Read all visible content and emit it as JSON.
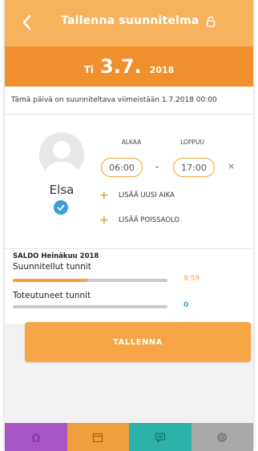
{
  "header": {
    "title": "Tallenna suunnitelma"
  },
  "date": {
    "day_of_week": "Ti",
    "day_month": "3.7.",
    "year": "2018"
  },
  "notice": "Tämä päivä on suunniteltava viimeistään 1.7.2018 00:00",
  "employee": {
    "name": "Elsa"
  },
  "shift": {
    "start_label": "ALKAA",
    "end_label": "LOPPUU",
    "start_time": "06:00",
    "end_time": "17:00",
    "separator": "-",
    "remove_symbol": "×"
  },
  "actions": {
    "add_time": "LISÄÄ UUSI AIKA",
    "add_absence": "LISÄÄ POISSAOLO",
    "plus_symbol": "+"
  },
  "saldo": {
    "title": "SALDO Heinäkuu 2018",
    "planned_label": "Suunnitellut tunnit",
    "planned_value": "9:59",
    "planned_progress": 0.48,
    "done_label": "Toteutuneet tunnit",
    "done_value": "0",
    "done_progress": 0
  },
  "save_button": "TALLENNA",
  "colors": {
    "header": "#f6b25c",
    "date_bar": "#f08f2c",
    "accent": "#f0a040",
    "blue": "#3a9ed8",
    "tab_home": "#a855c8",
    "tab_calendar": "#f0a040",
    "tab_messages": "#2ab3a6",
    "tab_settings": "#a9a9a9"
  },
  "tabs": [
    {
      "icon": "home-icon"
    },
    {
      "icon": "calendar-icon"
    },
    {
      "icon": "message-icon"
    },
    {
      "icon": "gear-icon"
    }
  ]
}
